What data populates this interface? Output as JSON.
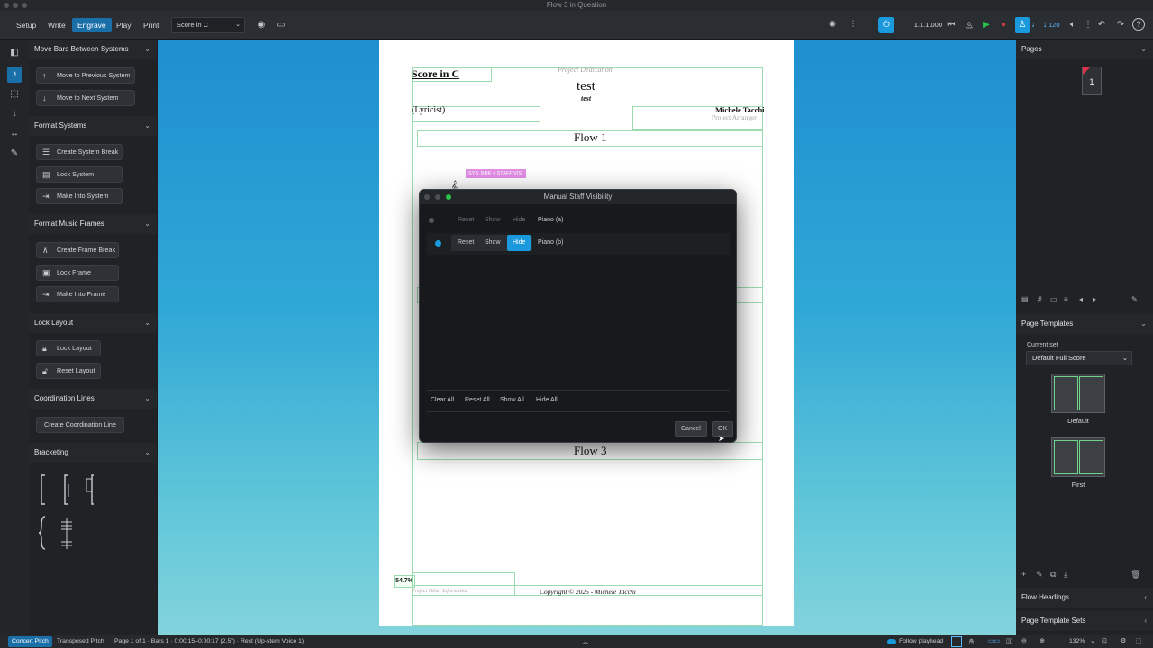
{
  "window": {
    "title": "Flow 3 in Question"
  },
  "toolbar": {
    "modes": [
      "Setup",
      "Write",
      "Engrave",
      "Play",
      "Print"
    ],
    "active_mode": "Engrave",
    "layout_select": "Score in C",
    "position": "1.1.1.000",
    "tempo": "120"
  },
  "left_panel": {
    "sections": [
      {
        "title": "Move Bars Between Systems",
        "buttons": [
          "Move to Previous System",
          "Move to Next System"
        ]
      },
      {
        "title": "Format Systems",
        "buttons": [
          "Create System Break",
          "Lock System",
          "Make Into System"
        ]
      },
      {
        "title": "Format Music Frames",
        "buttons": [
          "Create Frame Break",
          "Lock Frame",
          "Make Into Frame"
        ]
      },
      {
        "title": "Lock Layout",
        "buttons": [
          "Lock Layout",
          "Reset Layout"
        ]
      },
      {
        "title": "Coordination Lines",
        "buttons": [
          "Create Coordination Line"
        ]
      },
      {
        "title": "Bracketing",
        "buttons": []
      }
    ]
  },
  "score": {
    "layout_name": "Score in C",
    "dedication": "Project Dedication",
    "title": "test",
    "subtitle": "test",
    "lyricist": "(Lyricist)",
    "composer": "Michele Tacchi",
    "arranger": "Project Arranger",
    "flow1": "Flow 1",
    "flow3": "Flow 3",
    "signpost": "SYS. BRK + STAFF VIS.",
    "zoom_overlay": "54.7%",
    "other_info": "Project Other Information",
    "copyright": "Copyright © 2025 - Michele Tacchi"
  },
  "dialog": {
    "title": "Manual Staff Visibility",
    "rows": [
      {
        "name": "Piano (a)",
        "reset": "Reset",
        "show": "Show",
        "hide": "Hide",
        "state": "none"
      },
      {
        "name": "Piano (b)",
        "reset": "Reset",
        "show": "Show",
        "hide": "Hide",
        "state": "hide"
      }
    ],
    "footer_buttons": [
      "Clear All",
      "Reset All",
      "Show All",
      "Hide All"
    ],
    "cancel": "Cancel",
    "ok": "OK"
  },
  "right_panel": {
    "pages_title": "Pages",
    "page_number": "1",
    "page_templates_title": "Page Templates",
    "current_set_label": "Current set",
    "current_set": "Default Full Score",
    "templates": [
      "Default",
      "First"
    ],
    "flow_headings": "Flow Headings",
    "page_template_sets": "Page Template Sets"
  },
  "status": {
    "concert_pitch": "Concert Pitch",
    "transposed_pitch": "Transposed Pitch",
    "info": "Page 1 of 1 · Bars 1 · 0:00:15–0:00:17 (2.5\") · Rest (Up-stem Voice 1)",
    "follow_playhead": "Follow playhead",
    "zoom": "132%"
  },
  "colors": {
    "accent": "#1a99dc",
    "frame_guide": "#9bdcae",
    "signpost": "#e38ee6"
  }
}
